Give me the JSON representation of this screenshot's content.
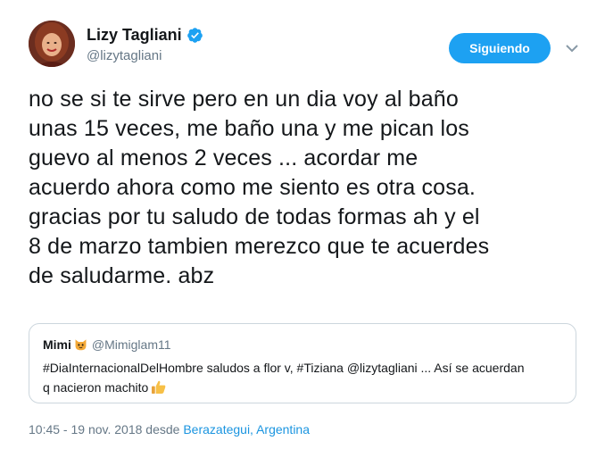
{
  "author": {
    "display_name": "Lizy Tagliani",
    "handle": "@lizytagliani",
    "verified": true
  },
  "follow_button": {
    "label": "Siguiendo"
  },
  "tweet": {
    "lines": [
      "no se si te sirve pero en un dia voy al baño",
      "unas 15 veces, me baño una y me pican los",
      "guevo al menos 2 veces ... acordar me",
      "acuerdo ahora como me siento es otra cosa.",
      "gracias por tu saludo de todas formas ah y el",
      "8 de marzo tambien merezco que te acuerdes",
      "de saludarme. abz"
    ]
  },
  "quoted_tweet": {
    "display_name": "Mimi",
    "handle": "@Mimiglam11",
    "line1": "#DiaInternacionalDelHombre saludos a flor v, #Tiziana @lizytagliani ... Así se acuerdan",
    "line2": "q nacieron machito"
  },
  "meta": {
    "timestamp": "10:45 - 19 nov. 2018",
    "from_label": "desde",
    "location": "Berazategui, Argentina"
  },
  "colors": {
    "accent": "#1da1f2",
    "link": "#1b95e0",
    "secondary_text": "#657786",
    "border": "#ccd6dd"
  },
  "icons": {
    "verified": "verified-badge-icon",
    "caret": "chevron-down-icon",
    "cat": "cat-face-emoji",
    "thumb": "thumbs-up-emoji"
  }
}
